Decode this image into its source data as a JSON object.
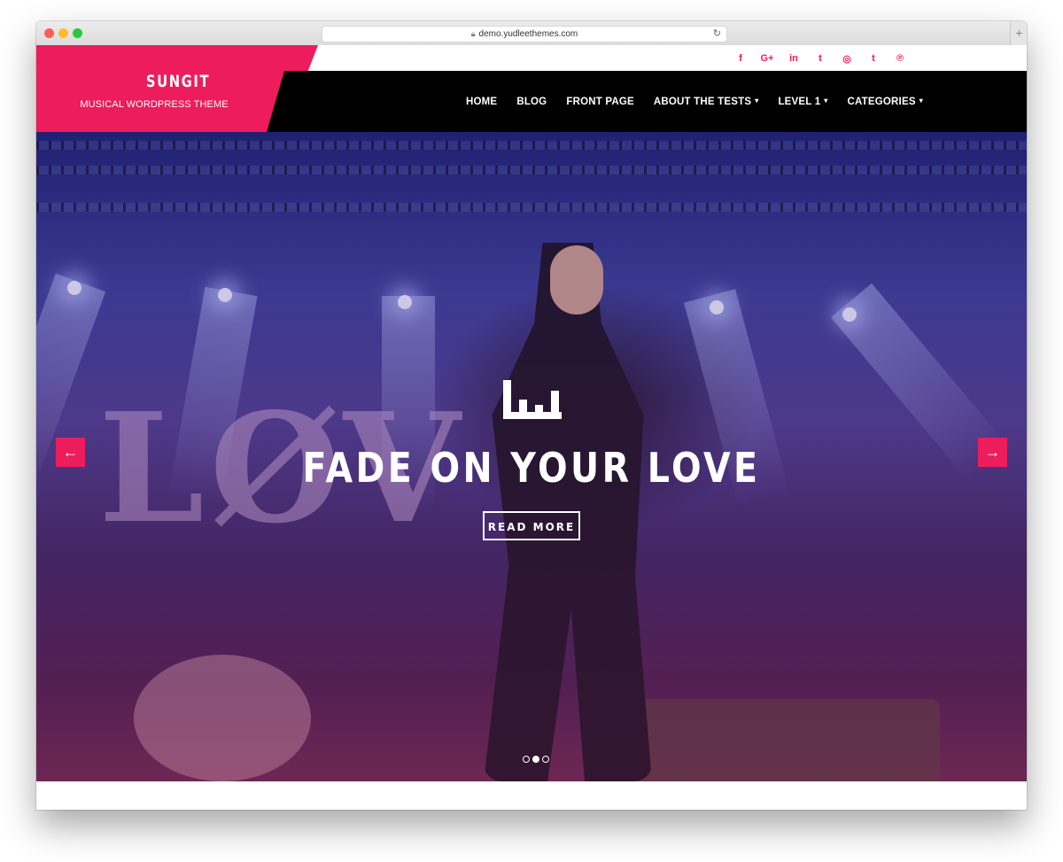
{
  "browser": {
    "url": "demo.yudleethemes.com",
    "new_tab_glyph": "+"
  },
  "site": {
    "brand_color": "#ed1c5c",
    "logo_title": "SUNGIT",
    "logo_tagline": "MUSICAL WORDPRESS THEME"
  },
  "social": {
    "icons": [
      "facebook-icon",
      "google-plus-icon",
      "linkedin-icon",
      "twitter-icon",
      "instagram-icon",
      "tumblr-icon",
      "pinterest-icon"
    ],
    "glyphs": [
      "f",
      "G+",
      "in",
      "t",
      "◎",
      "t",
      "℗"
    ]
  },
  "nav": {
    "items": [
      {
        "label": "HOME",
        "has_dropdown": false
      },
      {
        "label": "BLOG",
        "has_dropdown": false
      },
      {
        "label": "FRONT PAGE",
        "has_dropdown": false
      },
      {
        "label": "ABOUT THE TESTS",
        "has_dropdown": true
      },
      {
        "label": "LEVEL 1",
        "has_dropdown": true
      },
      {
        "label": "CATEGORIES",
        "has_dropdown": true
      }
    ],
    "caret": "▾"
  },
  "hero": {
    "title": "FADE ON YOUR LOVE",
    "button_label": "READ MORE",
    "prev_arrow": "←",
    "next_arrow": "→",
    "slides_total": 3,
    "active_slide": 2
  }
}
